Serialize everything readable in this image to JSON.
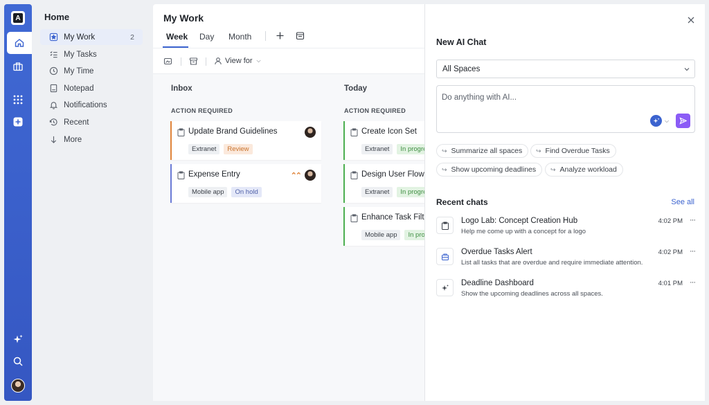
{
  "rail": {
    "logo_icon": "app-logo",
    "buttons": [
      "home-icon",
      "briefcase-icon",
      "apps-grid-icon",
      "add-square-icon",
      "ai-sparkle-icon",
      "search-icon"
    ],
    "accent": "#3b63cf"
  },
  "sidebar": {
    "home_label": "Home",
    "items": [
      {
        "label": "My Work",
        "icon": "star-badge-icon",
        "count": "2",
        "active": true
      },
      {
        "label": "My Tasks",
        "icon": "checklist-icon"
      },
      {
        "label": "My Time",
        "icon": "clock-icon"
      },
      {
        "label": "Notepad",
        "icon": "notepad-icon"
      },
      {
        "label": "Notifications",
        "icon": "bell-icon"
      },
      {
        "label": "Recent",
        "icon": "history-icon"
      },
      {
        "label": "More",
        "icon": "arrow-down-icon"
      }
    ]
  },
  "main": {
    "title": "My Work",
    "tabs": [
      {
        "label": "Week",
        "active": true
      },
      {
        "label": "Day"
      },
      {
        "label": "Month"
      }
    ],
    "view_for_label": "View for",
    "columns": [
      {
        "title": "Inbox",
        "subtitle": "ACTION REQUIRED",
        "cards": [
          {
            "title": "Update Brand Guidelines",
            "tags": [
              "Extranet",
              "Review"
            ],
            "accent": "#e0843a"
          },
          {
            "title": "Expense Entry",
            "tags": [
              "Mobile app",
              "On hold"
            ],
            "accent": "#6b7bd6"
          }
        ]
      },
      {
        "title": "Today",
        "subtitle": "ACTION REQUIRED",
        "cards": [
          {
            "title": "Create Icon Set",
            "tags": [
              "Extranet",
              "In progress"
            ],
            "accent": "#4caf50"
          },
          {
            "title": "Design User Flows",
            "tags": [
              "Extranet",
              "In progress"
            ],
            "accent": "#4caf50"
          },
          {
            "title": "Enhance Task Filters",
            "tags": [
              "Mobile app",
              "In progress"
            ],
            "accent": "#4caf50"
          }
        ]
      }
    ]
  },
  "panel": {
    "title": "New AI Chat",
    "space_select": "All Spaces",
    "prompt_placeholder": "Do anything with AI...",
    "suggestions": [
      "Summarize all spaces",
      "Find Overdue Tasks",
      "Show upcoming deadlines",
      "Analyze workload"
    ],
    "recent_title": "Recent chats",
    "see_all": "See all",
    "chats": [
      {
        "title": "Logo Lab: Concept Creation Hub",
        "desc": "Help me come up with a concept for a logo",
        "time": "4:02 PM",
        "icon": "clipboard-icon"
      },
      {
        "title": "Overdue Tasks Alert",
        "desc": "List all tasks that are overdue and require immediate attention.",
        "time": "4:02 PM",
        "icon": "briefcase-icon"
      },
      {
        "title": "Deadline Dashboard",
        "desc": "Show the upcoming deadlines across all spaces.",
        "time": "4:01 PM",
        "icon": "sparkle-icon"
      }
    ],
    "send_color": "#8b5cf6"
  }
}
